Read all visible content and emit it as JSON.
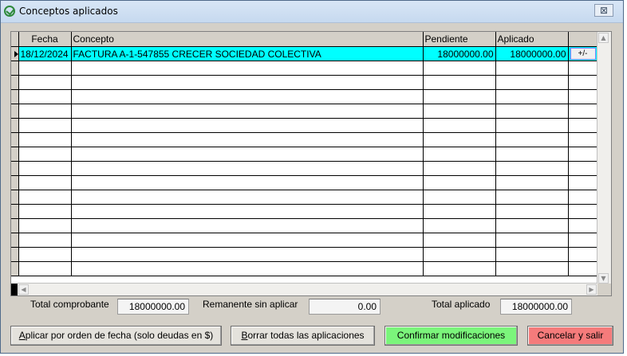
{
  "window": {
    "title": "Conceptos aplicados",
    "close_glyph": "⊠"
  },
  "grid": {
    "columns": [
      "Fecha",
      "Concepto",
      "Pendiente",
      "Aplicado",
      ""
    ],
    "rows": [
      {
        "fecha": "18/12/2024",
        "concepto": "FACTURA A-1-547855 CRECER SOCIEDAD COLECTIVA",
        "pendiente": "18000000.00",
        "aplicado": "18000000.00",
        "action": "+/-"
      }
    ],
    "empty_rows": 15
  },
  "totals": {
    "total_comprobante_label": "Total comprobante",
    "total_comprobante_value": "18000000.00",
    "remanente_label": "Remanente sin aplicar",
    "remanente_value": "0.00",
    "total_aplicado_label": "Total aplicado",
    "total_aplicado_value": "18000000.00"
  },
  "buttons": {
    "aplicar": {
      "first": "A",
      "rest": "plicar por orden de fecha (solo deudas en $)"
    },
    "borrar": {
      "first": "B",
      "rest": "orrar todas las aplicaciones"
    },
    "confirmar": {
      "label": "Confirmar modificaciones",
      "color": "#7bf57b"
    },
    "cancelar": {
      "label": "Cancelar y salir",
      "color": "#f57b7b"
    }
  }
}
